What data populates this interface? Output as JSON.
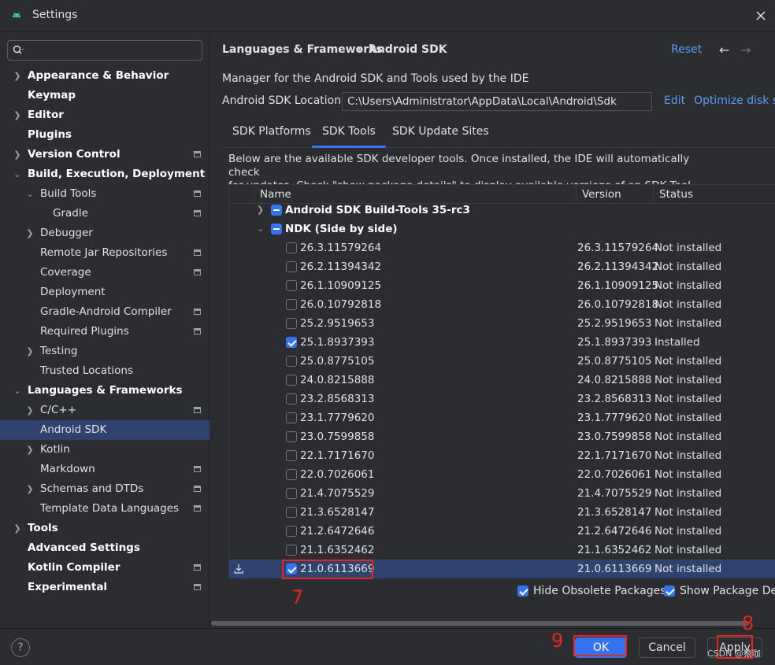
{
  "window": {
    "title": "Settings"
  },
  "sidebar": {
    "search_placeholder": "",
    "items": [
      {
        "label": "Appearance & Behavior"
      },
      {
        "label": "Keymap"
      },
      {
        "label": "Editor"
      },
      {
        "label": "Plugins"
      },
      {
        "label": "Version Control"
      },
      {
        "label": "Build, Execution, Deployment"
      },
      {
        "label": "Build Tools"
      },
      {
        "label": "Gradle"
      },
      {
        "label": "Debugger"
      },
      {
        "label": "Remote Jar Repositories"
      },
      {
        "label": "Coverage"
      },
      {
        "label": "Deployment"
      },
      {
        "label": "Gradle-Android Compiler"
      },
      {
        "label": "Required Plugins"
      },
      {
        "label": "Testing"
      },
      {
        "label": "Trusted Locations"
      },
      {
        "label": "Languages & Frameworks"
      },
      {
        "label": "C/C++"
      },
      {
        "label": "Android SDK"
      },
      {
        "label": "Kotlin"
      },
      {
        "label": "Markdown"
      },
      {
        "label": "Schemas and DTDs"
      },
      {
        "label": "Template Data Languages"
      },
      {
        "label": "Tools"
      },
      {
        "label": "Advanced Settings"
      },
      {
        "label": "Kotlin Compiler"
      },
      {
        "label": "Experimental"
      }
    ]
  },
  "header": {
    "breadcrumb_parent": "Languages & Frameworks",
    "breadcrumb_sep": "›",
    "breadcrumb_current": "Android SDK",
    "reset": "Reset"
  },
  "main": {
    "description": "Manager for the Android SDK and Tools used by the IDE",
    "location_label": "Android SDK Location:",
    "location_value": "C:\\Users\\Administrator\\AppData\\Local\\Android\\Sdk",
    "edit": "Edit",
    "optimize": "Optimize disk sp",
    "tabs": [
      {
        "label": "SDK Platforms"
      },
      {
        "label": "SDK Tools"
      },
      {
        "label": "SDK Update Sites"
      }
    ],
    "info_line1": "Below are the available SDK developer tools. Once installed, the IDE will automatically check",
    "info_line2": "for updates. Check \"show package details\" to display available versions of an SDK Tool."
  },
  "table": {
    "columns": {
      "name": "Name",
      "version": "Version",
      "status": "Status"
    },
    "groups": [
      {
        "name": "Android SDK Build-Tools 35-rc3"
      },
      {
        "name": "NDK (Side by side)"
      }
    ],
    "rows": [
      {
        "name": "26.3.11579264",
        "version": "26.3.11579264",
        "status": "Not installed"
      },
      {
        "name": "26.2.11394342",
        "version": "26.2.11394342",
        "status": "Not installed"
      },
      {
        "name": "26.1.10909125",
        "version": "26.1.10909125",
        "status": "Not installed"
      },
      {
        "name": "26.0.10792818",
        "version": "26.0.10792818",
        "status": "Not installed"
      },
      {
        "name": "25.2.9519653",
        "version": "25.2.9519653",
        "status": "Not installed"
      },
      {
        "name": "25.1.8937393",
        "version": "25.1.8937393",
        "status": "Installed"
      },
      {
        "name": "25.0.8775105",
        "version": "25.0.8775105",
        "status": "Not installed"
      },
      {
        "name": "24.0.8215888",
        "version": "24.0.8215888",
        "status": "Not installed"
      },
      {
        "name": "23.2.8568313",
        "version": "23.2.8568313",
        "status": "Not installed"
      },
      {
        "name": "23.1.7779620",
        "version": "23.1.7779620",
        "status": "Not installed"
      },
      {
        "name": "23.0.7599858",
        "version": "23.0.7599858",
        "status": "Not installed"
      },
      {
        "name": "22.1.7171670",
        "version": "22.1.7171670",
        "status": "Not installed"
      },
      {
        "name": "22.0.7026061",
        "version": "22.0.7026061",
        "status": "Not installed"
      },
      {
        "name": "21.4.7075529",
        "version": "21.4.7075529",
        "status": "Not installed"
      },
      {
        "name": "21.3.6528147",
        "version": "21.3.6528147",
        "status": "Not installed"
      },
      {
        "name": "21.2.6472646",
        "version": "21.2.6472646",
        "status": "Not installed"
      },
      {
        "name": "21.1.6352462",
        "version": "21.1.6352462",
        "status": "Not installed"
      },
      {
        "name": "21.0.6113669",
        "version": "21.0.6113669",
        "status": "Not installed"
      }
    ]
  },
  "options": {
    "hide_obsolete": "Hide Obsolete Packages",
    "show_details": "Show Package Deta"
  },
  "footer": {
    "help": "?",
    "ok": "OK",
    "cancel": "Cancel",
    "apply": "Apply"
  },
  "annotations": {
    "a7": "7",
    "a8": "8",
    "a9": "9"
  },
  "watermark": "CSDN @猿咖",
  "colors": {
    "accent": "#3574f0",
    "link": "#589df6",
    "selection": "#2e436e",
    "annotation": "#e8261f"
  }
}
